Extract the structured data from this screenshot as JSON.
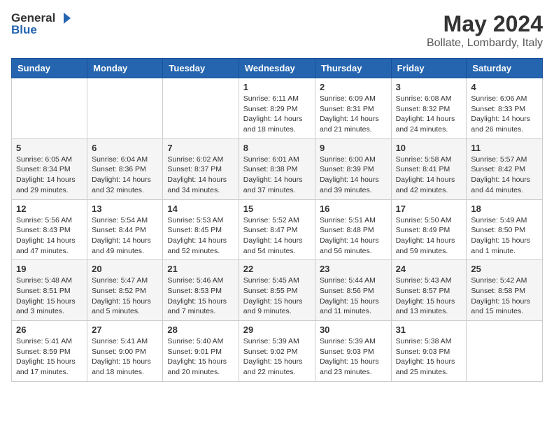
{
  "header": {
    "logo_general": "General",
    "logo_blue": "Blue",
    "month": "May 2024",
    "location": "Bollate, Lombardy, Italy"
  },
  "days_of_week": [
    "Sunday",
    "Monday",
    "Tuesday",
    "Wednesday",
    "Thursday",
    "Friday",
    "Saturday"
  ],
  "weeks": [
    [
      {
        "day": "",
        "info": ""
      },
      {
        "day": "",
        "info": ""
      },
      {
        "day": "",
        "info": ""
      },
      {
        "day": "1",
        "info": "Sunrise: 6:11 AM\nSunset: 8:29 PM\nDaylight: 14 hours\nand 18 minutes."
      },
      {
        "day": "2",
        "info": "Sunrise: 6:09 AM\nSunset: 8:31 PM\nDaylight: 14 hours\nand 21 minutes."
      },
      {
        "day": "3",
        "info": "Sunrise: 6:08 AM\nSunset: 8:32 PM\nDaylight: 14 hours\nand 24 minutes."
      },
      {
        "day": "4",
        "info": "Sunrise: 6:06 AM\nSunset: 8:33 PM\nDaylight: 14 hours\nand 26 minutes."
      }
    ],
    [
      {
        "day": "5",
        "info": "Sunrise: 6:05 AM\nSunset: 8:34 PM\nDaylight: 14 hours\nand 29 minutes."
      },
      {
        "day": "6",
        "info": "Sunrise: 6:04 AM\nSunset: 8:36 PM\nDaylight: 14 hours\nand 32 minutes."
      },
      {
        "day": "7",
        "info": "Sunrise: 6:02 AM\nSunset: 8:37 PM\nDaylight: 14 hours\nand 34 minutes."
      },
      {
        "day": "8",
        "info": "Sunrise: 6:01 AM\nSunset: 8:38 PM\nDaylight: 14 hours\nand 37 minutes."
      },
      {
        "day": "9",
        "info": "Sunrise: 6:00 AM\nSunset: 8:39 PM\nDaylight: 14 hours\nand 39 minutes."
      },
      {
        "day": "10",
        "info": "Sunrise: 5:58 AM\nSunset: 8:41 PM\nDaylight: 14 hours\nand 42 minutes."
      },
      {
        "day": "11",
        "info": "Sunrise: 5:57 AM\nSunset: 8:42 PM\nDaylight: 14 hours\nand 44 minutes."
      }
    ],
    [
      {
        "day": "12",
        "info": "Sunrise: 5:56 AM\nSunset: 8:43 PM\nDaylight: 14 hours\nand 47 minutes."
      },
      {
        "day": "13",
        "info": "Sunrise: 5:54 AM\nSunset: 8:44 PM\nDaylight: 14 hours\nand 49 minutes."
      },
      {
        "day": "14",
        "info": "Sunrise: 5:53 AM\nSunset: 8:45 PM\nDaylight: 14 hours\nand 52 minutes."
      },
      {
        "day": "15",
        "info": "Sunrise: 5:52 AM\nSunset: 8:47 PM\nDaylight: 14 hours\nand 54 minutes."
      },
      {
        "day": "16",
        "info": "Sunrise: 5:51 AM\nSunset: 8:48 PM\nDaylight: 14 hours\nand 56 minutes."
      },
      {
        "day": "17",
        "info": "Sunrise: 5:50 AM\nSunset: 8:49 PM\nDaylight: 14 hours\nand 59 minutes."
      },
      {
        "day": "18",
        "info": "Sunrise: 5:49 AM\nSunset: 8:50 PM\nDaylight: 15 hours\nand 1 minute."
      }
    ],
    [
      {
        "day": "19",
        "info": "Sunrise: 5:48 AM\nSunset: 8:51 PM\nDaylight: 15 hours\nand 3 minutes."
      },
      {
        "day": "20",
        "info": "Sunrise: 5:47 AM\nSunset: 8:52 PM\nDaylight: 15 hours\nand 5 minutes."
      },
      {
        "day": "21",
        "info": "Sunrise: 5:46 AM\nSunset: 8:53 PM\nDaylight: 15 hours\nand 7 minutes."
      },
      {
        "day": "22",
        "info": "Sunrise: 5:45 AM\nSunset: 8:55 PM\nDaylight: 15 hours\nand 9 minutes."
      },
      {
        "day": "23",
        "info": "Sunrise: 5:44 AM\nSunset: 8:56 PM\nDaylight: 15 hours\nand 11 minutes."
      },
      {
        "day": "24",
        "info": "Sunrise: 5:43 AM\nSunset: 8:57 PM\nDaylight: 15 hours\nand 13 minutes."
      },
      {
        "day": "25",
        "info": "Sunrise: 5:42 AM\nSunset: 8:58 PM\nDaylight: 15 hours\nand 15 minutes."
      }
    ],
    [
      {
        "day": "26",
        "info": "Sunrise: 5:41 AM\nSunset: 8:59 PM\nDaylight: 15 hours\nand 17 minutes."
      },
      {
        "day": "27",
        "info": "Sunrise: 5:41 AM\nSunset: 9:00 PM\nDaylight: 15 hours\nand 18 minutes."
      },
      {
        "day": "28",
        "info": "Sunrise: 5:40 AM\nSunset: 9:01 PM\nDaylight: 15 hours\nand 20 minutes."
      },
      {
        "day": "29",
        "info": "Sunrise: 5:39 AM\nSunset: 9:02 PM\nDaylight: 15 hours\nand 22 minutes."
      },
      {
        "day": "30",
        "info": "Sunrise: 5:39 AM\nSunset: 9:03 PM\nDaylight: 15 hours\nand 23 minutes."
      },
      {
        "day": "31",
        "info": "Sunrise: 5:38 AM\nSunset: 9:03 PM\nDaylight: 15 hours\nand 25 minutes."
      },
      {
        "day": "",
        "info": ""
      }
    ]
  ]
}
